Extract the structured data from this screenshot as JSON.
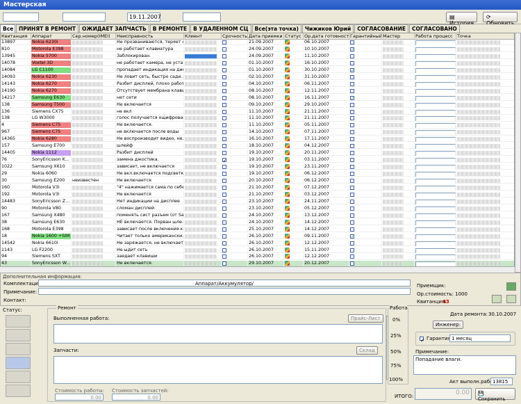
{
  "app": {
    "title": "Мастерская"
  },
  "filter": {
    "date": "19.11.2007",
    "history_label": "История",
    "refresh_label": "Обновить"
  },
  "tabs": [
    "Все",
    "ПРИНЯТ В РЕМОНТ",
    "ОЖИДАЕТ ЗАПЧАСТЬ",
    "В РЕМОНТЕ",
    "В УДАЛЕННОМ СЦ",
    "Все(эта точка)",
    "Чижиков Юрий",
    "СОГЛАСОВАНИЕ",
    "СОГЛАСОВАНО"
  ],
  "columns": [
    "Квитанция",
    "Аппарат",
    "Сер.номер(IMEI)",
    "Неисправность",
    "Клиент",
    "Срочность",
    "Дата приемки",
    "Статус",
    "Ор.дата готовности",
    "Гарантийный",
    "Мастер",
    "Работа процесс",
    "Точка"
  ],
  "rows": [
    {
      "num": "13897",
      "device": "Nokia 6230i",
      "fault": "Не прозваниваются, теряет с...",
      "date": "21.09.2007",
      "ready": "06.10.2007",
      "color": "#f08080",
      "warranty": false,
      "urgent": false
    },
    {
      "num": "810",
      "device": "Motorola E398",
      "fault": "не работает клавиатура",
      "date": "24.09.2007",
      "ready": "10.10.2007",
      "color": "#f08080",
      "warranty": true,
      "urgent": false
    },
    {
      "num": "13945",
      "device": "Nokia 5700",
      "fault": "Заблокирован.",
      "date": "24.09.2007",
      "ready": "11.10.2007",
      "color": "#f08080",
      "warranty": false,
      "urgent": false,
      "client_sel": true
    },
    {
      "num": "14078",
      "device": "Voxtel 3D",
      "fault": "не работает камера, не уста...",
      "date": "01.10.2007",
      "ready": "16.10.2007",
      "color": "#f08080",
      "warranty": false,
      "urgent": false
    },
    {
      "num": "14084",
      "device": "LG C1100",
      "fault": "пропадает индикация на дис...",
      "date": "01.10.2007",
      "ready": "30.10.2007",
      "color": "#80e080",
      "warranty": true,
      "urgent": false
    },
    {
      "num": "14093",
      "device": "Nokia 6230",
      "fault": "Не ловит сеть, быстро сади...",
      "date": "02.10.2007",
      "ready": "31.10.2007",
      "color": "#f08080",
      "warranty": false,
      "urgent": false
    },
    {
      "num": "14143",
      "device": "Nokia 6270",
      "fault": "Разбит дисплей, плохо работ...",
      "date": "04.10.2007",
      "ready": "06.11.2007",
      "color": "#f08080",
      "warranty": false,
      "urgent": false
    },
    {
      "num": "14190",
      "device": "Nokia 6270",
      "fault": "Отсутствует мембрана клави...",
      "date": "08.10.2007",
      "ready": "12.11.2007",
      "color": "#f08080",
      "warranty": false,
      "urgent": false
    },
    {
      "num": "14217",
      "device": "Samsung E630",
      "fault": "нет сети",
      "date": "08.10.2007",
      "ready": "16.11.2007",
      "color": "#80e080",
      "warranty": true,
      "urgent": false
    },
    {
      "num": "138",
      "device": "Samsung T500",
      "fault": "Не включается",
      "date": "09.10.2007",
      "ready": "29.10.2007",
      "color": "#f08080",
      "warranty": false,
      "urgent": false
    },
    {
      "num": "136",
      "device": "Siemens CX75",
      "fault": "не вкл",
      "date": "11.10.2007",
      "ready": "21.11.2007",
      "color": "",
      "warranty": false,
      "urgent": false
    },
    {
      "num": "138",
      "device": "LG W3000",
      "fault": "голос получается ощифрован...",
      "date": "11.10.2007",
      "ready": "21.11.2007",
      "color": "",
      "warranty": false,
      "urgent": false
    },
    {
      "num": "4",
      "device": "Siemens C75",
      "fault": "Не включается.",
      "date": "11.10.2007",
      "ready": "05.11.2007",
      "color": "#f08080",
      "warranty": false,
      "urgent": false
    },
    {
      "num": "967",
      "device": "Siemens C75",
      "fault": "не включается после воды",
      "date": "14.10.2007",
      "ready": "07.11.2007",
      "color": "#f08080",
      "warranty": false,
      "urgent": false
    },
    {
      "num": "14365",
      "device": "Nokia 6280",
      "fault": "Не воспроизводит видео, не...",
      "date": "16.10.2007",
      "ready": "17.11.2007",
      "color": "#f08080",
      "warranty": false,
      "urgent": false
    },
    {
      "num": "157",
      "device": "Samsung E700",
      "fault": "шлейф",
      "date": "18.10.2007",
      "ready": "04.12.2007",
      "color": "",
      "warranty": false,
      "urgent": false
    },
    {
      "num": "14405",
      "device": "Nokia 1112",
      "fault": "Разбит дисплей",
      "date": "19.10.2007",
      "ready": "20.11.2007",
      "color": "#c8a0f0",
      "warranty": false,
      "urgent": false
    },
    {
      "num": "76",
      "device": "SonyEricsson K...",
      "fault": "замена джостика.",
      "date": "19.10.2007",
      "ready": "03.11.2007",
      "color": "",
      "warranty": false,
      "urgent": true
    },
    {
      "num": "1022",
      "device": "Samsung X610",
      "fault": "зависает, не включается",
      "date": "19.10.2007",
      "ready": "23.11.2007",
      "color": "",
      "warranty": false,
      "urgent": false
    },
    {
      "num": "29",
      "device": "Nokia 6060",
      "fault": "Не вкл.включается подсветка д...",
      "date": "19.10.2007",
      "ready": "06.12.2007",
      "color": "",
      "warranty": false,
      "urgent": false
    },
    {
      "num": "30",
      "device": "Samsung E200",
      "imei": "неизвестен",
      "fault": "Не включается",
      "date": "20.10.2007",
      "ready": "06.12.2007",
      "color": "",
      "warranty": false,
      "urgent": false
    },
    {
      "num": "160",
      "device": "Motorola V3i",
      "fault": "\"4\" нажимается сама по себе",
      "date": "21.10.2007",
      "ready": "07.12.2007",
      "color": "",
      "warranty": false,
      "urgent": false
    },
    {
      "num": "192",
      "device": "Motorola V3i",
      "fault": "Не включается",
      "date": "21.10.2007",
      "ready": "03.12.2007",
      "color": "",
      "warranty": false,
      "urgent": false
    },
    {
      "num": "14483",
      "device": "SonyEricsson Z...",
      "fault": "Нет индикации на дисплее",
      "date": "23.10.2007",
      "ready": "24.11.2007",
      "color": "",
      "warranty": false,
      "urgent": false
    },
    {
      "num": "90",
      "device": "Motorola V80",
      "fault": "сломан дисплей",
      "date": "23.10.2007",
      "ready": "05.12.2007",
      "color": "",
      "warranty": false,
      "urgent": false
    },
    {
      "num": "167",
      "device": "Samsung X480",
      "fault": "поменять сист разъем (от Sa...",
      "date": "24.10.2007",
      "ready": "13.12.2007",
      "color": "",
      "warranty": false,
      "urgent": false
    },
    {
      "num": "38",
      "device": "Samsung E630",
      "fault": "НЕ включается. Порван шле...",
      "date": "24.10.2007",
      "ready": "14.12.2007",
      "color": "",
      "warranty": false,
      "urgent": false
    },
    {
      "num": "168",
      "device": "Motorola E398",
      "fault": "зависает после включения к...",
      "date": "25.10.2007",
      "ready": "14.12.2007",
      "color": "",
      "warranty": false,
      "urgent": false
    },
    {
      "num": "18",
      "device": "Nokia 1600 +SIM",
      "fault": "Читает только американски...",
      "date": "26.10.2007",
      "ready": "09.11.2007",
      "color": "#80e080",
      "warranty": true,
      "urgent": false
    },
    {
      "num": "14542",
      "device": "Nokia 6610i",
      "fault": "Не заряжается, не включается",
      "date": "26.10.2007",
      "ready": "12.12.2007",
      "color": "",
      "warranty": false,
      "urgent": false
    },
    {
      "num": "1143",
      "device": "LG F2200",
      "fault": "Не ыдит сеть",
      "date": "26.10.2007",
      "ready": "15.11.2007",
      "color": "",
      "warranty": false,
      "urgent": false
    },
    {
      "num": "94",
      "device": "Siemens SXT",
      "fault": "заедает клавиши",
      "date": "26.10.2007",
      "ready": "12.12.2007",
      "color": "",
      "warranty": false,
      "urgent": false
    },
    {
      "num": "43",
      "device": "SonyEricsson W...",
      "fault": "Не включается.",
      "date": "29.10.2007",
      "ready": "20.12.2007",
      "color": "",
      "warranty": false,
      "urgent": false,
      "highlight": true
    },
    {
      "num": "2444",
      "device": "Nokia 6630",
      "fault": "Разбит дисплей",
      "date": "29.10.2007",
      "ready": "29.11.2007",
      "color": "",
      "warranty": false,
      "urgent": false
    }
  ],
  "info": {
    "title": "Дополнительная информация:",
    "komplekt_label": "Комплектация:",
    "komplekt_value": "Аппарат/Аккумулятор/",
    "note_label": "Примечание:",
    "contact_label": "Контакт:",
    "receiver_label": "Приемщик:",
    "cost_label": "Ор.стоимость: 1000",
    "receipt_label": "Квитанция:",
    "receipt_value": "43"
  },
  "repair": {
    "status_label": "Статус:",
    "repair_label": "Ремонт",
    "done_label": "Выполненная работа:",
    "price_label": "Прайс-Лист",
    "parts_label": "Запчасти:",
    "stock_label": "Склад",
    "work_cost_label": "Стоимость работы:",
    "work_cost": "0.00",
    "parts_cost_label": "Стоимость запчастей:",
    "parts_cost": "0.00",
    "work_label": "Работа",
    "pcts": [
      "0%",
      "25%",
      "50%",
      "75%",
      "100%"
    ],
    "date_label": "Дата ремонта:",
    "date_value": "30.10.2007",
    "engineer_label": "Инженер:",
    "warranty_label": "Гарантия",
    "warranty_value": "1 месяц",
    "note_label": "Примечание:",
    "note_value": "Попадание влаги.",
    "act_label": "Акт выполн.работ:",
    "act_value": "13815",
    "total_label": "ИТОГО:",
    "total_value": "0.00",
    "save_label": "Сохранить"
  }
}
